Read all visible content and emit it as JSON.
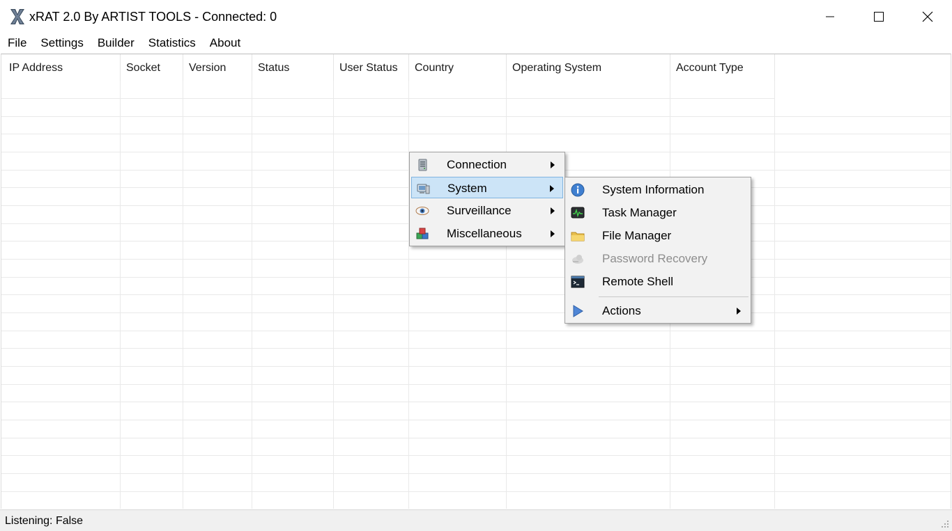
{
  "window": {
    "title": "xRAT 2.0 By ARTIST TOOLS - Connected: 0"
  },
  "menubar": {
    "items": [
      "File",
      "Settings",
      "Builder",
      "Statistics",
      "About"
    ]
  },
  "listview": {
    "columns": [
      "IP Address",
      "Socket",
      "Version",
      "Status",
      "User Status",
      "Country",
      "Operating System",
      "Account Type"
    ]
  },
  "context_menu": {
    "items": [
      {
        "label": "Connection",
        "icon": "server-icon",
        "has_submenu": true
      },
      {
        "label": "System",
        "icon": "computer-icon",
        "has_submenu": true,
        "highlighted": true
      },
      {
        "label": "Surveillance",
        "icon": "eye-icon",
        "has_submenu": true
      },
      {
        "label": "Miscellaneous",
        "icon": "cubes-icon",
        "has_submenu": true
      }
    ]
  },
  "submenu_system": {
    "items": [
      {
        "label": "System Information",
        "icon": "info-icon",
        "enabled": true
      },
      {
        "label": "Task Manager",
        "icon": "monitor-graph-icon",
        "enabled": true
      },
      {
        "label": "File Manager",
        "icon": "folder-icon",
        "enabled": true
      },
      {
        "label": "Password Recovery",
        "icon": "key-cloud-icon",
        "enabled": false
      },
      {
        "label": "Remote Shell",
        "icon": "terminal-icon",
        "enabled": true
      },
      {
        "label": "Actions",
        "icon": "play-icon",
        "enabled": true,
        "has_submenu": true
      }
    ]
  },
  "statusbar": {
    "text": "Listening: False"
  },
  "colors": {
    "highlight_bg": "#cce4f7",
    "highlight_border": "#7fb4e0",
    "menu_bg": "#f2f2f2",
    "disabled_text": "#8d8d8d"
  }
}
